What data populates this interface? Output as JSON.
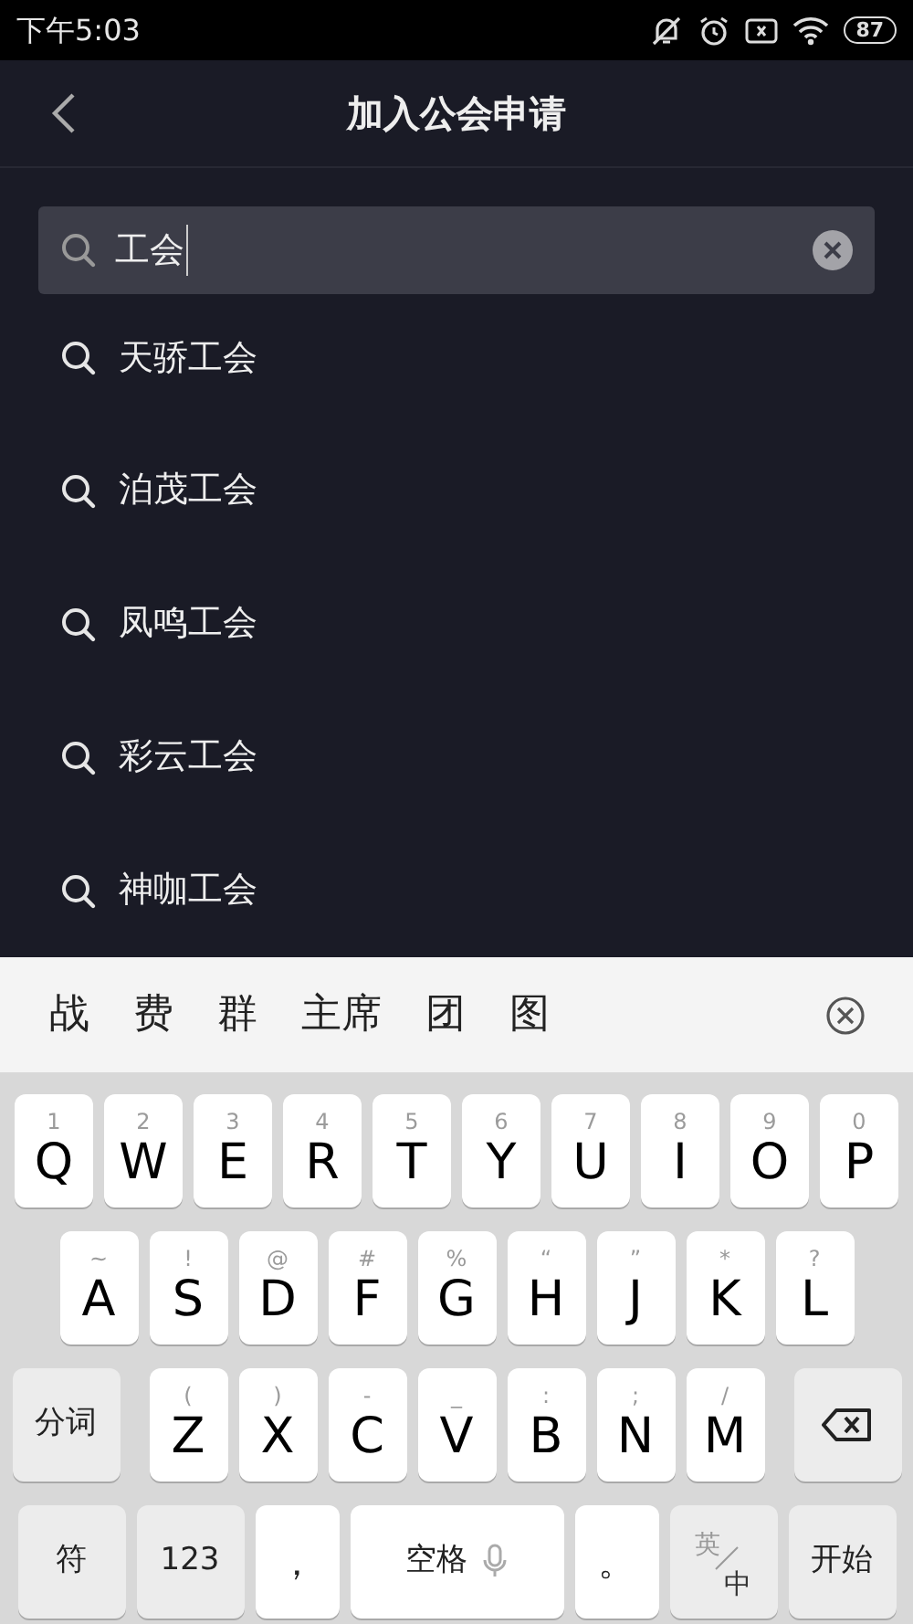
{
  "status_bar": {
    "time": "下午5:03",
    "battery": "87"
  },
  "header": {
    "title": "加入公会申请"
  },
  "search": {
    "value": "工会"
  },
  "suggestions": [
    {
      "text": "天骄工会"
    },
    {
      "text": "泊茂工会"
    },
    {
      "text": "凤鸣工会"
    },
    {
      "text": "彩云工会"
    },
    {
      "text": "神咖工会"
    }
  ],
  "candidates": [
    "战",
    "费",
    "群",
    "主席",
    "团",
    "图"
  ],
  "keyboard": {
    "rows": [
      {
        "keys": [
          {
            "kind": "letter",
            "label": "Q",
            "hint": "1"
          },
          {
            "kind": "letter",
            "label": "W",
            "hint": "2"
          },
          {
            "kind": "letter",
            "label": "E",
            "hint": "3"
          },
          {
            "kind": "letter",
            "label": "R",
            "hint": "4"
          },
          {
            "kind": "letter",
            "label": "T",
            "hint": "5"
          },
          {
            "kind": "letter",
            "label": "Y",
            "hint": "6"
          },
          {
            "kind": "letter",
            "label": "U",
            "hint": "7"
          },
          {
            "kind": "letter",
            "label": "I",
            "hint": "8"
          },
          {
            "kind": "letter",
            "label": "O",
            "hint": "9"
          },
          {
            "kind": "letter",
            "label": "P",
            "hint": "0"
          }
        ]
      },
      {
        "keys": [
          {
            "kind": "letter",
            "label": "A",
            "hint": "~"
          },
          {
            "kind": "letter",
            "label": "S",
            "hint": "!"
          },
          {
            "kind": "letter",
            "label": "D",
            "hint": "@"
          },
          {
            "kind": "letter",
            "label": "F",
            "hint": "#"
          },
          {
            "kind": "letter",
            "label": "G",
            "hint": "%"
          },
          {
            "kind": "letter",
            "label": "H",
            "hint": "“"
          },
          {
            "kind": "letter",
            "label": "J",
            "hint": "”"
          },
          {
            "kind": "letter",
            "label": "K",
            "hint": "*"
          },
          {
            "kind": "letter",
            "label": "L",
            "hint": "?"
          }
        ]
      },
      {
        "keys": [
          {
            "kind": "segment",
            "label": "分词"
          },
          {
            "kind": "letter",
            "label": "Z",
            "hint": "("
          },
          {
            "kind": "letter",
            "label": "X",
            "hint": ")"
          },
          {
            "kind": "letter",
            "label": "C",
            "hint": "-"
          },
          {
            "kind": "letter",
            "label": "V",
            "hint": "_"
          },
          {
            "kind": "letter",
            "label": "B",
            "hint": ":"
          },
          {
            "kind": "letter",
            "label": "N",
            "hint": ";"
          },
          {
            "kind": "letter",
            "label": "M",
            "hint": "/"
          },
          {
            "kind": "backspace"
          }
        ]
      },
      {
        "keys": [
          {
            "kind": "function",
            "label": "符"
          },
          {
            "kind": "function",
            "label": "123"
          },
          {
            "kind": "punct",
            "label": "，"
          },
          {
            "kind": "space",
            "label": "空格"
          },
          {
            "kind": "punct",
            "label": "。"
          },
          {
            "kind": "lang",
            "label": "英",
            "sub": "中"
          },
          {
            "kind": "function",
            "label": "开始"
          }
        ]
      }
    ]
  }
}
